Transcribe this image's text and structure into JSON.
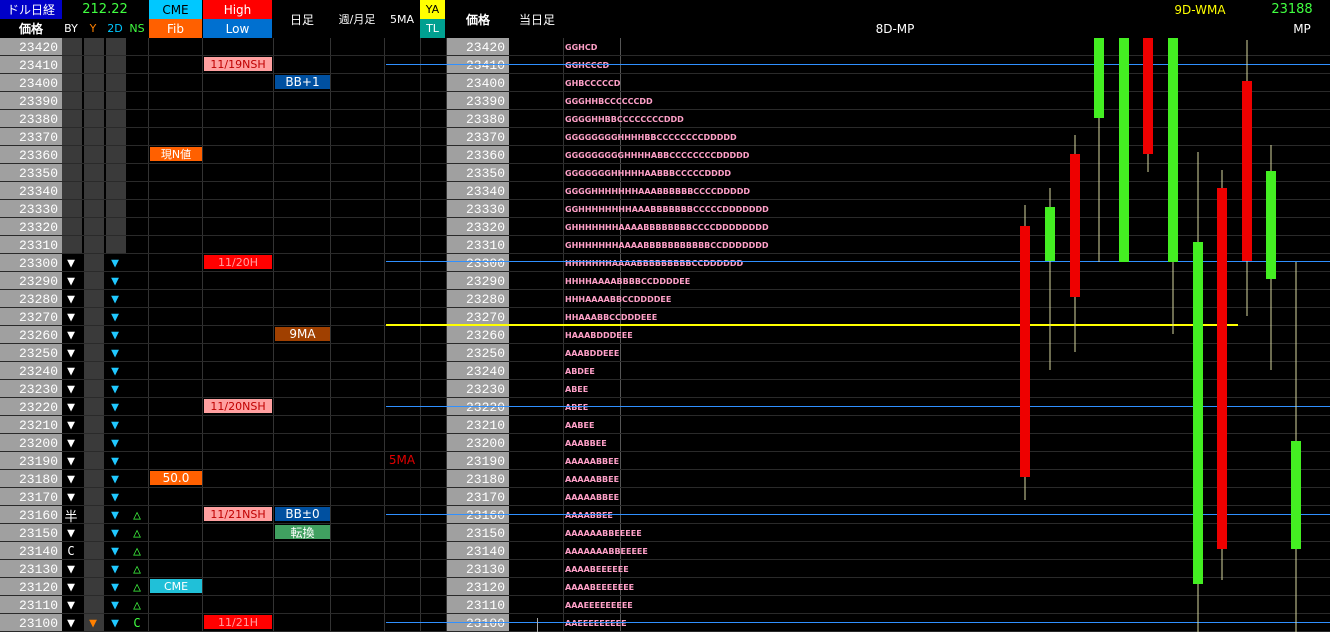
{
  "header": {
    "title": "ドル日経",
    "price_label": "価格",
    "value": "212.22",
    "by": "BY",
    "y": "Y",
    "d2": "2D",
    "ns": "NS",
    "cme": "CME",
    "fib": "Fib",
    "high": "High",
    "low": "Low",
    "daily": "日足",
    "weekly_monthly": "週/月足",
    "ma5": "5MA",
    "ya": "YA",
    "tl": "TL",
    "price_label2": "価格",
    "today": "当日足",
    "mp8d": "8D-MP",
    "wma9d": "9D-WMA",
    "mp_value": "23188",
    "mp": "MP"
  },
  "prices": [
    "23420",
    "23410",
    "23400",
    "23390",
    "23380",
    "23370",
    "23360",
    "23350",
    "23340",
    "23330",
    "23320",
    "23310",
    "23300",
    "23290",
    "23280",
    "23270",
    "23260",
    "23250",
    "23240",
    "23230",
    "23220",
    "23210",
    "23200",
    "23190",
    "23180",
    "23170",
    "23160",
    "23150",
    "23140",
    "23130",
    "23120",
    "23110",
    "23100"
  ],
  "tpo": [
    "GGHCD",
    "GGHCCCD",
    "GHBCCCCCD",
    "GGGHHBCCCCCCDD",
    "GGGGHHBBCCCCCCCCDDD",
    "GGGGGGGGHHHHBBCCCCCCCCDDDDD",
    "GGGGGGGGGHHHHABBCCCCCCCCDDDDD",
    "GGGGGGGHHHHHAABBBCCCCCDDDD",
    "GGGGHHHHHHHAAABBBBBBCCCCDDDDD",
    "GGHHHHHHHHAAABBBBBBBCCCCCDDDDDDD",
    "GHHHHHHHAAAABBBBBBBBCCCCDDDDDDDD",
    "GHHHHHHHAAAABBBBBBBBBBBCCDDDDDDD",
    "HHHHHHHAAAABBBBBBBBBCCDDDDDD",
    "HHHHAAAABBBBCCDDDDEE",
    "HHHAAAABBCCDDDDEE",
    "HHAAABBCCDDDEEE",
    "HAAABDDDEEE",
    "AAABDDEEE",
    "ABDEE",
    "ABEE",
    "ABEE",
    "AABEE",
    "AAABBEE",
    "AAAAABBEE",
    "AAAAABBEE",
    "AAAAABBEE",
    "AAAABBEE",
    "AAAAAABBEEEEE",
    "AAAAAAABBEEEEE",
    "AAAABEEEEEE",
    "AAAABEEEEEEE",
    "AAAEEEEEEEEE",
    "AAEEEEEEEEE"
  ],
  "by_marks": {
    "triangle": "▼",
    "half": "半",
    "c": "C"
  },
  "y_marks": {
    "triangle": "▼"
  },
  "d2_marks": {
    "triangle": "▼"
  },
  "ns_marks": {
    "up": "△",
    "c": "C"
  },
  "labels": {
    "cme_genne": "現N値",
    "fib_50": "50.0",
    "cme_bottom": "CME",
    "nsh_1119": "11/19NSH",
    "h_1120": "11/20H",
    "nsh_1120": "11/20NSH",
    "nsh_1121": "11/21NSH",
    "h_1121": "11/21H",
    "bb_plus1": "BB+1",
    "ma9": "9MA",
    "bb_0": "BB±0",
    "tenkan": "転換",
    "ma5_label": "5MA"
  },
  "colors": {
    "price_bg": "#a0a0a0",
    "header_cyan": "#00c8ff",
    "fib_orange": "#ff6000",
    "high_red": "#ff0000",
    "low_blue": "#0070d0",
    "candle_red": "#ee0000",
    "candle_green": "#44ee22",
    "yellow_line": "#ffff00",
    "blue_line": "#3090ff"
  }
}
